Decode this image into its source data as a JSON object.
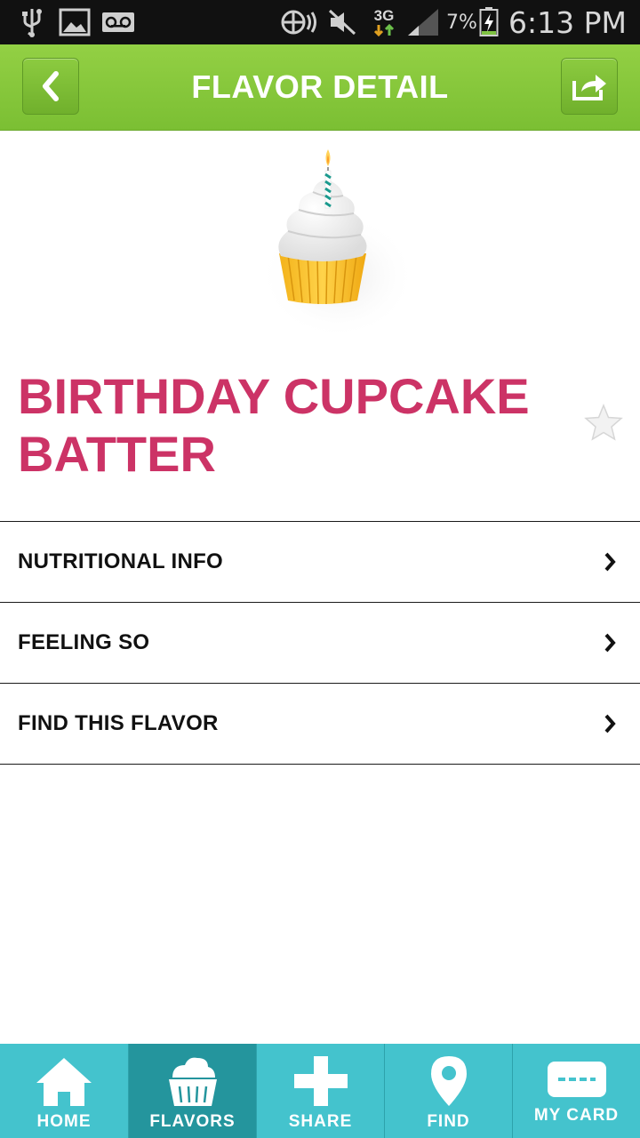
{
  "status_bar": {
    "battery_percent": "7%",
    "network_type": "3G",
    "time": "6:13 PM",
    "icons": [
      "usb-icon",
      "image-icon",
      "voicemail-icon",
      "nfc-icon",
      "mute-icon",
      "network-3g-icon",
      "signal-icon",
      "battery-charging-icon"
    ]
  },
  "header": {
    "title": "FLAVOR DETAIL",
    "back_icon": "chevron-left-icon",
    "share_icon": "share-icon"
  },
  "flavor": {
    "name": "BIRTHDAY CUPCAKE BATTER",
    "image": "cupcake-with-candle",
    "favorite_icon": "star-icon",
    "is_favorite": false
  },
  "menu": {
    "items": [
      {
        "label": "NUTRITIONAL INFO"
      },
      {
        "label": "FEELING SO"
      },
      {
        "label": "FIND THIS FLAVOR"
      }
    ]
  },
  "bottom_nav": {
    "items": [
      {
        "label": "HOME",
        "icon": "home-icon"
      },
      {
        "label": "FLAVORS",
        "icon": "cup-icon",
        "active": true
      },
      {
        "label": "SHARE",
        "icon": "plus-icon"
      },
      {
        "label": "FIND",
        "icon": "map-pin-icon"
      },
      {
        "label": "MY CARD",
        "icon": "card-icon"
      }
    ]
  },
  "colors": {
    "header_green": "#8cc63f",
    "title_pink": "#cc3366",
    "nav_teal": "#44c3cd",
    "nav_active": "#24959d"
  }
}
